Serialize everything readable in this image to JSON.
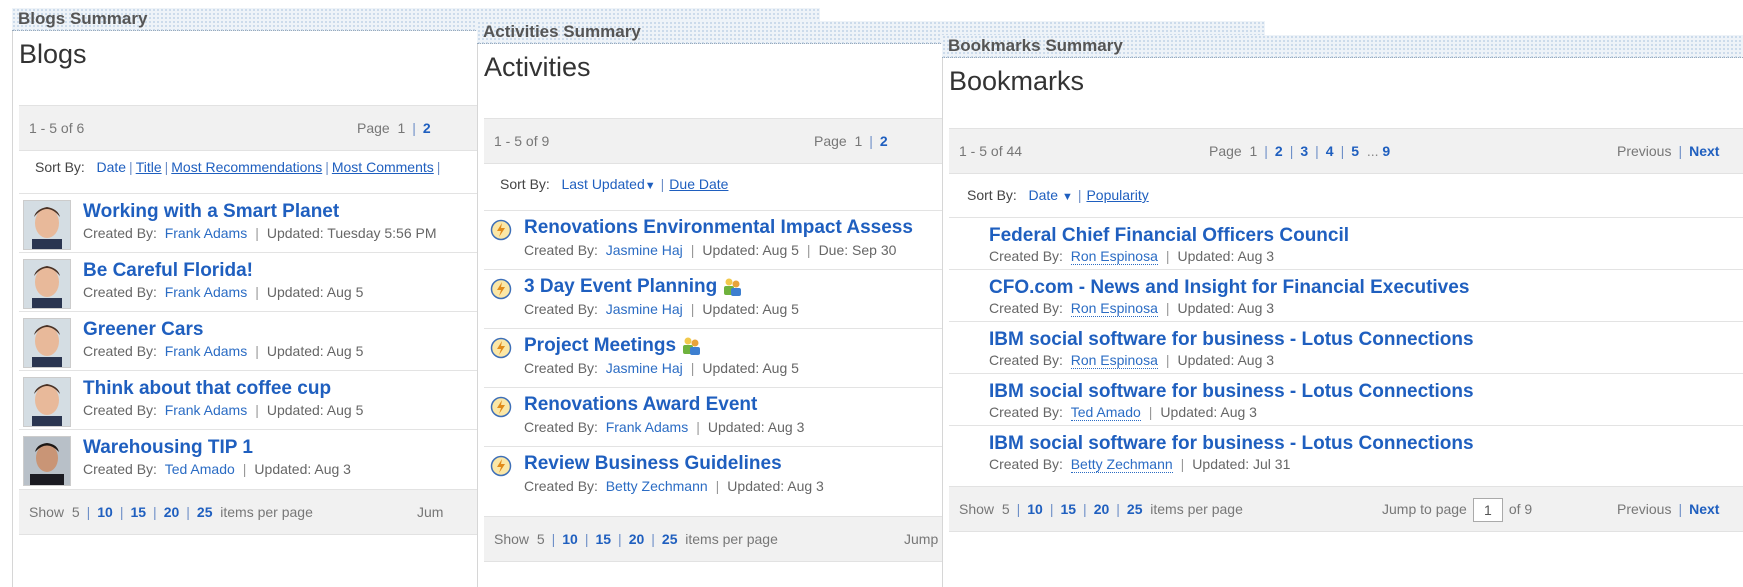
{
  "blogs": {
    "header": "Blogs Summary",
    "title": "Blogs",
    "range": "1 - 5 of 6",
    "page_label": "Page",
    "pages": [
      "1",
      "2"
    ],
    "sort_label": "Sort By:",
    "sort_options": [
      "Date",
      "Title",
      "Most Recommendations",
      "Most Comments"
    ],
    "created_by_label": "Created By:",
    "entries": [
      {
        "title": "Working with a Smart Planet",
        "author": "Frank Adams",
        "updated": "Updated: Tuesday 5:56 PM"
      },
      {
        "title": "Be Careful Florida!",
        "author": "Frank Adams",
        "updated": "Updated: Aug 5"
      },
      {
        "title": "Greener Cars",
        "author": "Frank Adams",
        "updated": "Updated: Aug 5"
      },
      {
        "title": "Think about that coffee cup",
        "author": "Frank Adams",
        "updated": "Updated: Aug 5"
      },
      {
        "title": "Warehousing TIP 1",
        "author": "Ted Amado",
        "updated": "Updated: Aug 3"
      }
    ],
    "show_label": "Show",
    "show_current": "5",
    "show_options": [
      "10",
      "15",
      "20",
      "25"
    ],
    "items_per_page": "items per page",
    "jump_label": "Jum"
  },
  "activities": {
    "header": "Activities Summary",
    "title": "Activities",
    "range": "1 - 5 of 9",
    "page_label": "Page",
    "pages": [
      "1",
      "2"
    ],
    "sort_label": "Sort By:",
    "sort_primary": "Last Updated",
    "sort_secondary": "Due Date",
    "created_by_label": "Created By:",
    "entries": [
      {
        "title": "Renovations Environmental Impact Assess",
        "author": "Jasmine Haj",
        "updated": "Updated: Aug 5",
        "due": "Due: Sep 30",
        "group": false
      },
      {
        "title": "3 Day Event Planning",
        "author": "Jasmine Haj",
        "updated": "Updated: Aug 5",
        "due": "",
        "group": true
      },
      {
        "title": "Project Meetings",
        "author": "Jasmine Haj",
        "updated": "Updated: Aug 5",
        "due": "",
        "group": true
      },
      {
        "title": "Renovations Award Event",
        "author": "Frank Adams",
        "updated": "Updated: Aug 3",
        "due": "",
        "group": false
      },
      {
        "title": "Review Business Guidelines",
        "author": "Betty Zechmann",
        "updated": "Updated: Aug 3",
        "due": "",
        "group": false
      }
    ],
    "show_label": "Show",
    "show_current": "5",
    "show_options": [
      "10",
      "15",
      "20",
      "25"
    ],
    "items_per_page": "items per page",
    "jump_label": "Jump"
  },
  "bookmarks": {
    "header": "Bookmarks Summary",
    "title": "Bookmarks",
    "range": "1 - 5 of 44",
    "page_label": "Page",
    "pages": [
      "1",
      "2",
      "3",
      "4",
      "5"
    ],
    "ellipsis": "...",
    "last_page": "9",
    "previous": "Previous",
    "next": "Next",
    "sort_label": "Sort By:",
    "sort_primary": "Date",
    "sort_secondary": "Popularity",
    "created_by_label": "Created By:",
    "entries": [
      {
        "title": "Federal Chief Financial Officers Council",
        "author": "Ron Espinosa",
        "updated": "Updated: Aug 3"
      },
      {
        "title": "CFO.com - News and Insight for Financial Executives",
        "author": "Ron Espinosa",
        "updated": "Updated: Aug 3"
      },
      {
        "title": "IBM social software for business - Lotus Connections",
        "author": "Ron Espinosa",
        "updated": "Updated: Aug 3"
      },
      {
        "title": "IBM social software for business - Lotus Connections",
        "author": "Ted Amado",
        "updated": "Updated: Aug 3"
      },
      {
        "title": "IBM social software for business - Lotus Connections",
        "author": "Betty Zechmann",
        "updated": "Updated: Jul 31"
      }
    ],
    "show_label": "Show",
    "show_current": "5",
    "show_options": [
      "10",
      "15",
      "20",
      "25"
    ],
    "items_per_page": "items per page",
    "jump_label": "Jump to page",
    "jump_value": "1",
    "of_pages": "of 9"
  },
  "colors": {
    "link": "#1f5fbf",
    "band": "#f1f1f1",
    "header_bg": "#eef3f8"
  }
}
